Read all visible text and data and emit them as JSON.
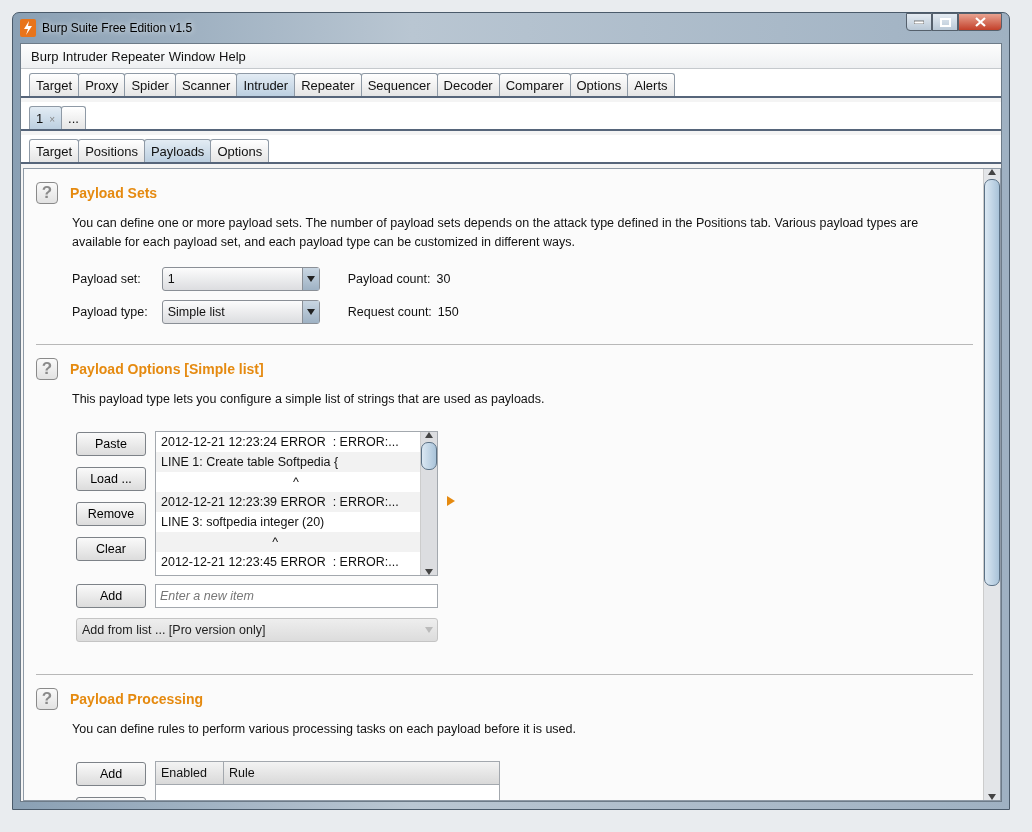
{
  "window": {
    "title": "Burp Suite Free Edition v1.5"
  },
  "menu": [
    "Burp",
    "Intruder",
    "Repeater",
    "Window",
    "Help"
  ],
  "tool_tabs": [
    {
      "label": "Target",
      "selected": false
    },
    {
      "label": "Proxy",
      "selected": false
    },
    {
      "label": "Spider",
      "selected": false
    },
    {
      "label": "Scanner",
      "selected": false
    },
    {
      "label": "Intruder",
      "selected": true
    },
    {
      "label": "Repeater",
      "selected": false
    },
    {
      "label": "Sequencer",
      "selected": false
    },
    {
      "label": "Decoder",
      "selected": false
    },
    {
      "label": "Comparer",
      "selected": false
    },
    {
      "label": "Options",
      "selected": false
    },
    {
      "label": "Alerts",
      "selected": false
    }
  ],
  "attack_tabs": [
    {
      "label": "1",
      "close": "×",
      "selected": true
    },
    {
      "label": "...",
      "selected": false
    }
  ],
  "intruder_tabs": [
    {
      "label": "Target",
      "selected": false
    },
    {
      "label": "Positions",
      "selected": false
    },
    {
      "label": "Payloads",
      "selected": true
    },
    {
      "label": "Options",
      "selected": false
    }
  ],
  "payload_sets": {
    "help": "?",
    "title": "Payload Sets",
    "description": "You can define one or more payload sets. The number of payload sets depends on the attack type defined in the Positions tab. Various payload types are available for each payload set, and each payload type can be customized in different ways.",
    "fields": [
      {
        "label": "Payload set:",
        "value": "1"
      },
      {
        "label": "Payload type:",
        "value": "Simple list"
      }
    ],
    "stats": [
      {
        "label": "Payload count:",
        "value": "30"
      },
      {
        "label": "Request count:",
        "value": "150"
      }
    ]
  },
  "payload_options": {
    "help": "?",
    "title": "Payload Options [Simple list]",
    "description": "This payload type lets you configure a simple list of strings that are used as payloads.",
    "buttons": [
      "Paste",
      "Load ...",
      "Remove",
      "Clear"
    ],
    "items": [
      "2012-12-21 12:23:24 ERROR  : ERROR:...",
      "LINE 1: Create table Softpedia {",
      "                                      ^",
      "2012-12-21 12:23:39 ERROR  : ERROR:...",
      "LINE 3: softpedia integer (20)",
      "                                ^",
      "2012-12-21 12:23:45 ERROR  : ERROR:..."
    ],
    "add_button": "Add",
    "new_item": {
      "placeholder": "Enter a new item"
    },
    "add_from_list": {
      "value": "Add from list ... [Pro version only]",
      "disabled": true
    }
  },
  "payload_processing": {
    "help": "?",
    "title": "Payload Processing",
    "description": "You can define rules to perform various processing tasks on each payload before it is used.",
    "add_button": "Add",
    "table": {
      "columns": [
        "Enabled",
        "Rule"
      ]
    }
  }
}
